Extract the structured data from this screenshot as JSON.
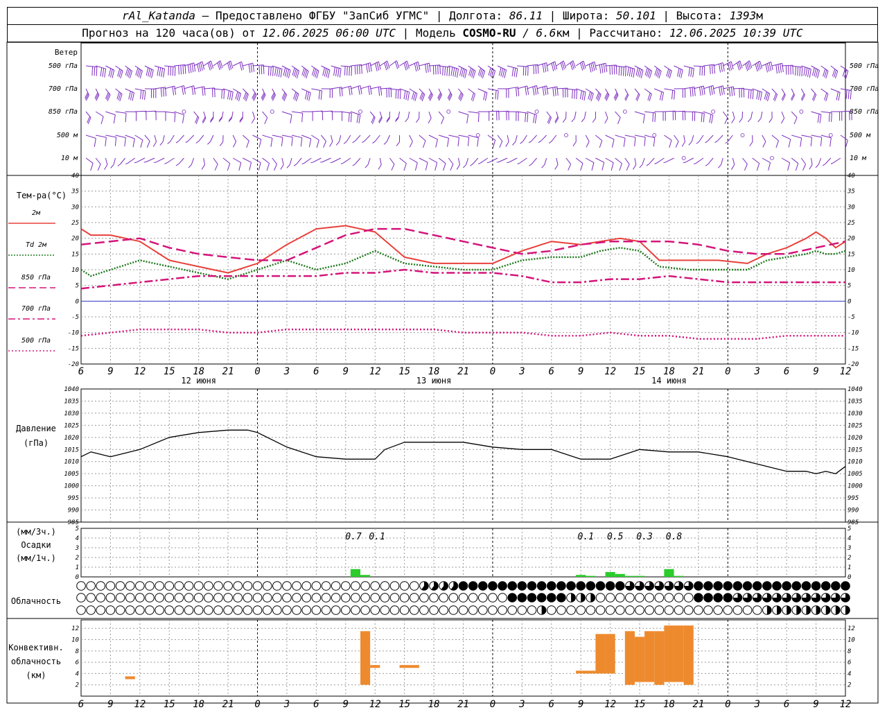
{
  "header": {
    "station": "rAl_Katanda",
    "dash": " — ",
    "provided_by": "Предоставлено ФГБУ \"ЗапСиб УГМС\"",
    "lon_label": "Долгота:",
    "lon_value": "86.11",
    "lat_label": "Широта:",
    "lat_value": "50.101",
    "alt_label": "Высота:",
    "alt_value": "1393",
    "alt_unit": "м",
    "sep": " | ",
    "forecast_label": "Прогноз на 120 часа(ов) от",
    "forecast_time": "12.06.2025 06:00 UTC",
    "model_label": "Модель",
    "model_name": "COSMO-RU",
    "model_res": " / 6.6",
    "model_res_unit": "км",
    "calc_label": "Рассчитано:",
    "calc_time": "12.06.2025 10:39 UTC"
  },
  "time_axis": {
    "hour_labels": [
      "6",
      "9",
      "12",
      "15",
      "18",
      "21",
      "0",
      "3",
      "6",
      "9",
      "12",
      "15",
      "18",
      "21",
      "0",
      "3",
      "6",
      "9",
      "12",
      "15",
      "18",
      "21",
      "0",
      "3",
      "6",
      "9",
      "12"
    ],
    "day_labels": [
      {
        "text": "12 июня",
        "hour": 12
      },
      {
        "text": "13 июня",
        "hour": 36
      },
      {
        "text": "14 июня",
        "hour": 60
      }
    ],
    "midnights": [
      18,
      42,
      66,
      90
    ]
  },
  "wind_panel": {
    "title": "Ветер",
    "levels": [
      "500 гПа",
      "700 гПа",
      "850 гПа",
      "500 м",
      "10 м"
    ]
  },
  "temp_panel": {
    "title": "Тем-ра(°С)",
    "legend": [
      {
        "label": "2м",
        "color": "#e8403a",
        "style": "solid"
      },
      {
        "label": "Td  2м",
        "color": "#1f7a1f",
        "style": "dotted"
      },
      {
        "label": "850 гПа",
        "color": "#d4147a",
        "style": "dashed"
      },
      {
        "label": "700 гПа",
        "color": "#d4147a",
        "style": "dashdot"
      },
      {
        "label": "500 гПа",
        "color": "#d4147a",
        "style": "dots"
      }
    ],
    "y_ticks": [
      "40",
      "35",
      "30",
      "25",
      "20",
      "15",
      "10",
      "5",
      "0",
      "-5",
      "-10",
      "-15",
      "-20"
    ]
  },
  "pressure_panel": {
    "title": "Давление",
    "unit": "(гПа)",
    "y_ticks": [
      "1040",
      "1035",
      "1030",
      "1025",
      "1020",
      "1015",
      "1010",
      "1005",
      "1000",
      "995",
      "990",
      "985"
    ]
  },
  "precip_panel": {
    "unit3": "(мм/3ч.)",
    "title": "Осадки",
    "unit1": "(мм/1ч.)",
    "y_ticks": [
      "5",
      "4",
      "3",
      "2",
      "1",
      "0"
    ],
    "totals": [
      {
        "hour": 27.8,
        "text": "0.7"
      },
      {
        "hour": 30.2,
        "text": "0.1"
      },
      {
        "hour": 51.5,
        "text": "0.1"
      },
      {
        "hour": 54.5,
        "text": "0.5"
      },
      {
        "hour": 57.5,
        "text": "0.3"
      },
      {
        "hour": 60.5,
        "text": "0.8"
      }
    ]
  },
  "cloud_panel": {
    "title": "Облачность"
  },
  "conv_panel": {
    "title1": "Конвективн.",
    "title2": "облачность",
    "unit": "(км)",
    "y_ticks": [
      "12",
      "10",
      "8",
      "6",
      "4",
      "2"
    ]
  },
  "colors": {
    "wind": "#7b2cbf",
    "temp2m": "#e8403a",
    "dew": "#1f7a1f",
    "upper": "#d4147a",
    "zero": "#3a3ad0",
    "precip": "#2bcc2b",
    "conv": "#ee8a2e"
  },
  "chart_data": {
    "type": "line",
    "x_unit": "hours since 12.06.2025 06:00 UTC",
    "xlim": [
      0,
      78
    ],
    "series": [
      {
        "name": "2м",
        "x": [
          0,
          1,
          3,
          6,
          9,
          12,
          15,
          18,
          21,
          24,
          27,
          30,
          33,
          36,
          39,
          42,
          45,
          48,
          51,
          53,
          55,
          57,
          59,
          62,
          65,
          68,
          70,
          72,
          74,
          75,
          76,
          77,
          78
        ],
        "y": [
          23,
          21,
          21,
          19,
          13,
          11,
          9,
          12,
          18,
          23,
          24,
          22,
          14,
          12,
          12,
          12,
          16,
          19,
          18,
          19,
          20,
          19,
          13,
          13,
          13,
          12,
          15,
          17,
          20,
          22,
          20,
          17,
          19
        ]
      },
      {
        "name": "Td  2м",
        "x": [
          0,
          1,
          3,
          6,
          9,
          12,
          15,
          18,
          21,
          24,
          27,
          30,
          33,
          36,
          39,
          42,
          45,
          48,
          51,
          53,
          55,
          57,
          59,
          62,
          65,
          68,
          70,
          72,
          74,
          75,
          76,
          77,
          78
        ],
        "y": [
          10,
          8,
          10,
          13,
          11,
          9,
          7,
          10,
          13,
          10,
          12,
          16,
          12,
          11,
          10,
          10,
          13,
          14,
          14,
          16,
          17,
          16,
          11,
          10,
          10,
          10,
          13,
          14,
          15,
          16,
          15,
          15,
          16
        ]
      },
      {
        "name": "850 гПа",
        "x": [
          0,
          3,
          6,
          9,
          12,
          15,
          18,
          21,
          24,
          27,
          30,
          33,
          36,
          39,
          42,
          45,
          48,
          51,
          54,
          57,
          60,
          63,
          66,
          69,
          72,
          75,
          78
        ],
        "y": [
          18,
          19,
          20,
          17,
          15,
          14,
          13,
          13,
          17,
          21,
          23,
          23,
          21,
          19,
          17,
          15,
          16,
          18,
          19,
          19,
          19,
          18,
          16,
          15,
          15,
          17,
          19
        ]
      },
      {
        "name": "700 гПа",
        "x": [
          0,
          3,
          6,
          9,
          12,
          15,
          18,
          21,
          24,
          27,
          30,
          33,
          36,
          39,
          42,
          45,
          48,
          51,
          54,
          57,
          60,
          63,
          66,
          69,
          72,
          75,
          78
        ],
        "y": [
          4,
          5,
          6,
          7,
          8,
          8,
          8,
          8,
          8,
          9,
          9,
          10,
          9,
          9,
          9,
          8,
          6,
          6,
          7,
          7,
          8,
          7,
          6,
          6,
          6,
          6,
          6
        ]
      },
      {
        "name": "500 гПа",
        "x": [
          0,
          3,
          6,
          9,
          12,
          15,
          18,
          21,
          24,
          27,
          30,
          33,
          36,
          39,
          42,
          45,
          48,
          51,
          54,
          57,
          60,
          63,
          66,
          69,
          72,
          75,
          78
        ],
        "y": [
          -11,
          -10,
          -9,
          -9,
          -9,
          -10,
          -10,
          -9,
          -9,
          -9,
          -9,
          -9,
          -9,
          -10,
          -10,
          -10,
          -11,
          -11,
          -10,
          -11,
          -11,
          -12,
          -12,
          -12,
          -11,
          -11,
          -11
        ]
      },
      {
        "name": "Давление",
        "x": [
          0,
          1,
          3,
          6,
          9,
          12,
          15,
          17,
          18,
          19,
          21,
          24,
          27,
          30,
          31,
          33,
          36,
          39,
          42,
          45,
          48,
          51,
          54,
          57,
          60,
          63,
          66,
          68,
          70,
          72,
          74,
          75,
          76,
          77,
          78
        ],
        "y": [
          1012,
          1014,
          1012,
          1015,
          1020,
          1022,
          1023,
          1023,
          1022,
          1020,
          1016,
          1012,
          1011,
          1011,
          1015,
          1018,
          1018,
          1018,
          1016,
          1015,
          1015,
          1011,
          1011,
          1015,
          1014,
          1014,
          1012,
          1010,
          1008,
          1006,
          1006,
          1005,
          1006,
          1005,
          1008
        ]
      }
    ],
    "precip_mm_per_h": [
      {
        "hour": 28,
        "value": 0.8
      },
      {
        "hour": 29,
        "value": 0.2
      },
      {
        "hour": 51,
        "value": 0.2
      },
      {
        "hour": 52,
        "value": 0.1
      },
      {
        "hour": 54,
        "value": 0.5
      },
      {
        "hour": 55,
        "value": 0.3
      },
      {
        "hour": 56,
        "value": 0.1
      },
      {
        "hour": 57,
        "value": 0.1
      },
      {
        "hour": 60,
        "value": 0.8
      },
      {
        "hour": 61,
        "value": 0.1
      }
    ],
    "convective_cloud_km": [
      {
        "from": 4.5,
        "to": 5.5,
        "base": 3.0,
        "top": 3.5
      },
      {
        "from": 28.5,
        "to": 29.5,
        "base": 2.0,
        "top": 11.5
      },
      {
        "from": 29.5,
        "to": 30.5,
        "base": 5.0,
        "top": 5.5
      },
      {
        "from": 32.5,
        "to": 34.5,
        "base": 5.0,
        "top": 5.5
      },
      {
        "from": 50.5,
        "to": 52.5,
        "base": 4.0,
        "top": 4.5
      },
      {
        "from": 52.5,
        "to": 53.5,
        "base": 4.0,
        "top": 11.0
      },
      {
        "from": 53.5,
        "to": 54.5,
        "base": 4.0,
        "top": 11.0
      },
      {
        "from": 55.5,
        "to": 56.5,
        "base": 2.0,
        "top": 11.5
      },
      {
        "from": 56.5,
        "to": 57.5,
        "base": 2.5,
        "top": 10.5
      },
      {
        "from": 57.5,
        "to": 58.5,
        "base": 2.5,
        "top": 11.5
      },
      {
        "from": 58.5,
        "to": 59.5,
        "base": 2.0,
        "top": 11.5
      },
      {
        "from": 59.5,
        "to": 60.5,
        "base": 2.5,
        "top": 12.5
      },
      {
        "from": 60.5,
        "to": 61.5,
        "base": 2.5,
        "top": 12.5
      },
      {
        "from": 61.5,
        "to": 62.5,
        "base": 2.0,
        "top": 12.5
      }
    ],
    "cloud_cover_fraction": {
      "row1": [
        {
          "from": 0,
          "to": 35,
          "value": 0
        },
        {
          "from": 35,
          "to": 39,
          "value": 0.6
        },
        {
          "from": 39,
          "to": 56,
          "value": 1
        },
        {
          "from": 56,
          "to": 63,
          "value": 0.75
        },
        {
          "from": 63,
          "to": 78,
          "value": 1
        }
      ],
      "row2": [
        {
          "from": 0,
          "to": 44,
          "value": 0
        },
        {
          "from": 44,
          "to": 50,
          "value": 1
        },
        {
          "from": 50,
          "to": 53,
          "value": 0.5
        },
        {
          "from": 53,
          "to": 63,
          "value": 0
        },
        {
          "from": 63,
          "to": 67,
          "value": 1
        },
        {
          "from": 67,
          "to": 78,
          "value": 0.75
        }
      ],
      "row3": [
        {
          "from": 0,
          "to": 47,
          "value": 0
        },
        {
          "from": 47,
          "to": 48,
          "value": 0.5
        },
        {
          "from": 48,
          "to": 70,
          "value": 0
        },
        {
          "from": 70,
          "to": 78,
          "value": 0.5
        }
      ]
    }
  }
}
